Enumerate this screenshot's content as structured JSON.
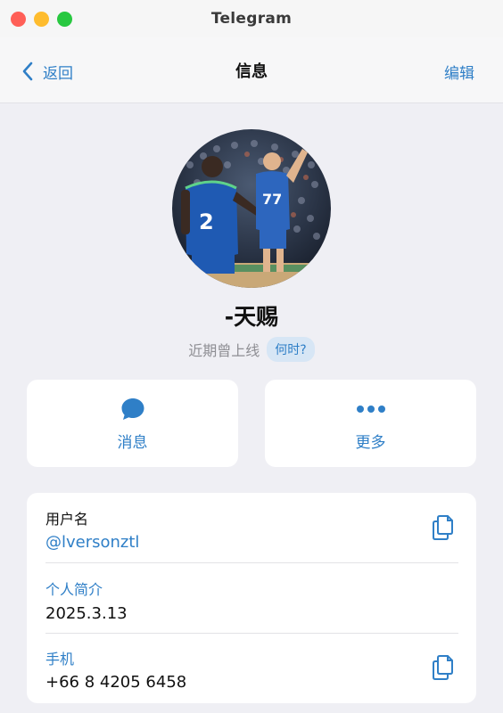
{
  "window": {
    "title": "Telegram"
  },
  "navbar": {
    "back_label": "返回",
    "title": "信息",
    "edit_label": "编辑"
  },
  "profile": {
    "name": "-天赐",
    "status": "近期曾上线",
    "when_badge": "何时?"
  },
  "actions": {
    "message_label": "消息",
    "more_label": "更多"
  },
  "info": {
    "username_label": "用户名",
    "username_value": "@lversonztl",
    "bio_label": "个人简介",
    "bio_value": "2025.3.13",
    "phone_label": "手机",
    "phone_value": "+66 8 4205 6458"
  },
  "colors": {
    "accent": "#2f7fc7",
    "background": "#efeff4",
    "card": "#ffffff"
  }
}
